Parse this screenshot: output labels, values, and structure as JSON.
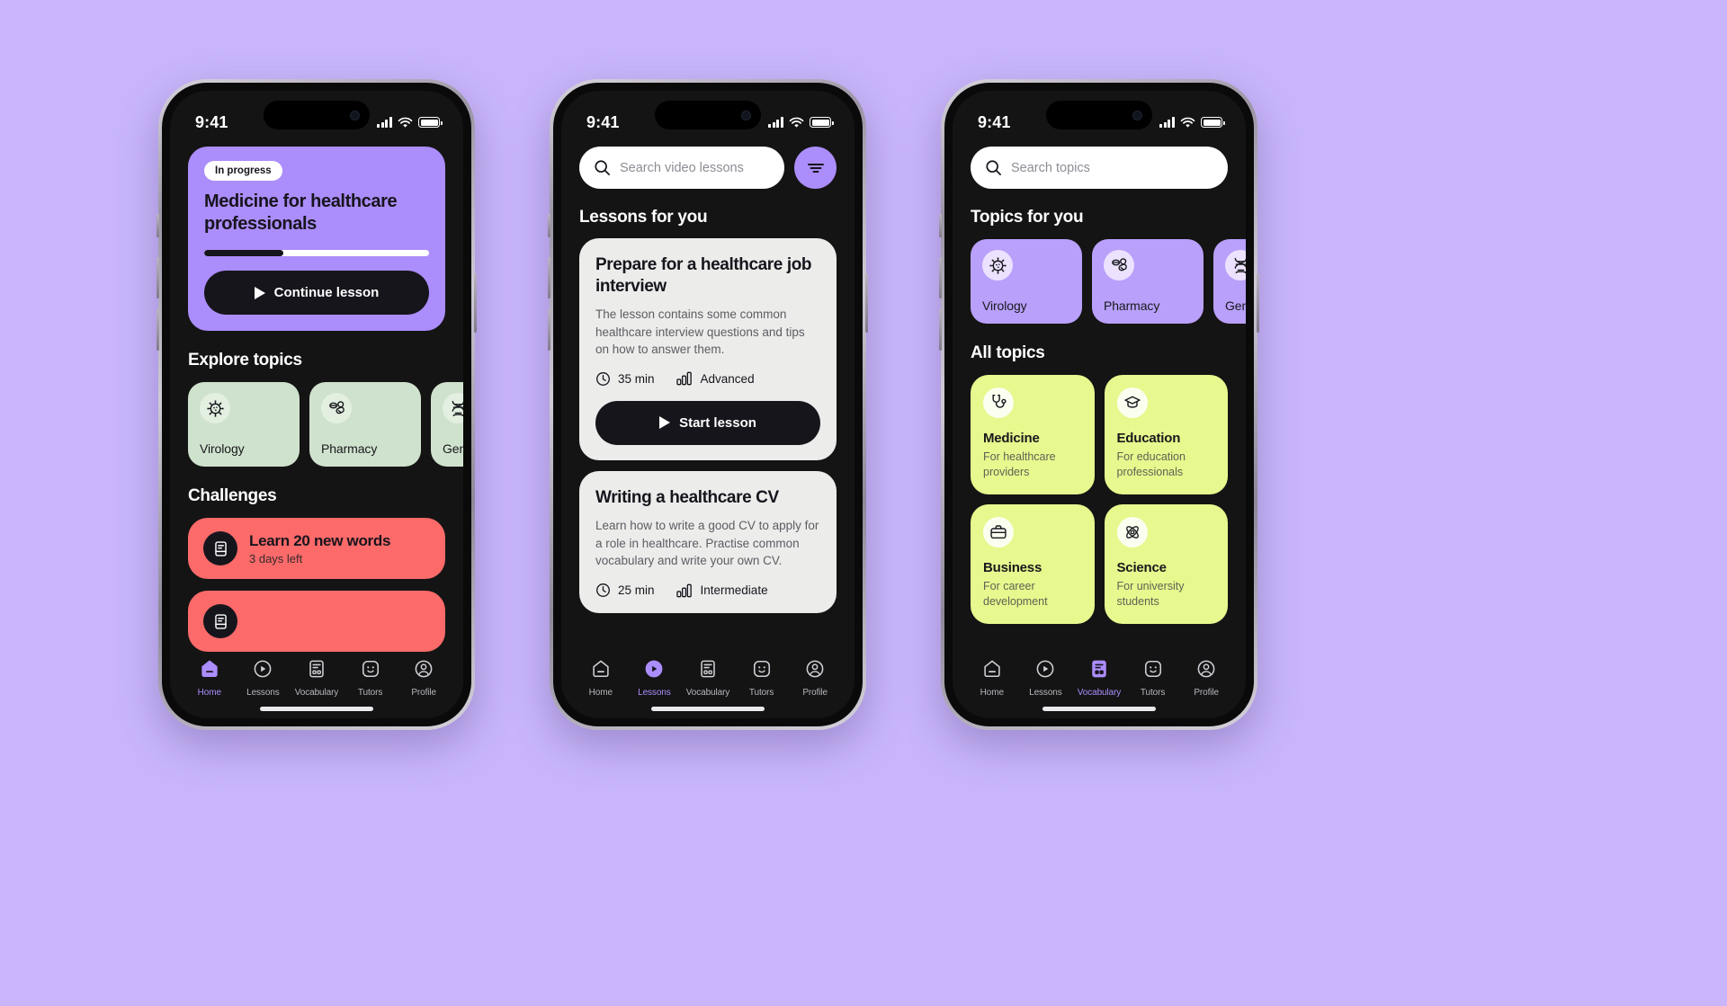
{
  "background_color": "#c9b6fa",
  "status_bar": {
    "time": "9:41",
    "signal_icon": "cellular-bars-icon",
    "wifi_icon": "wifi-icon",
    "battery_icon": "battery-icon"
  },
  "colors": {
    "purple": "#ab8dfb",
    "green_chip": "#cfe2cd",
    "lime": "#e7f88e",
    "red": "#fc6a6a",
    "dark": "#141414",
    "card_grey": "#ececeb"
  },
  "tabs": [
    {
      "label": "Home",
      "icon": "home-icon"
    },
    {
      "label": "Lessons",
      "icon": "play-circle-icon"
    },
    {
      "label": "Vocabulary",
      "icon": "vocabulary-book-icon"
    },
    {
      "label": "Tutors",
      "icon": "smiley-face-icon"
    },
    {
      "label": "Profile",
      "icon": "person-circle-icon"
    }
  ],
  "phone1": {
    "active_tab": "Home",
    "hero": {
      "status_pill": "In progress",
      "title": "Medicine for healthcare professionals",
      "progress_percent": 35,
      "button_label": "Continue lesson",
      "button_icon": "play-icon"
    },
    "explore_heading": "Explore topics",
    "topics": [
      {
        "label": "Virology",
        "icon": "virus-icon"
      },
      {
        "label": "Pharmacy",
        "icon": "pills-icon"
      },
      {
        "label": "Genetics",
        "icon": "dna-icon"
      }
    ],
    "challenges_heading": "Challenges",
    "challenges": [
      {
        "title": "Learn 20 new words",
        "subtitle": "3 days left",
        "icon": "flashcard-icon"
      },
      {
        "title": "",
        "subtitle": "",
        "icon": "flashcard-icon"
      }
    ]
  },
  "phone2": {
    "active_tab": "Lessons",
    "search": {
      "placeholder": "Search video lessons",
      "value": "",
      "icon": "search-icon"
    },
    "filter_button_icon": "filter-icon",
    "heading": "Lessons for you",
    "lessons": [
      {
        "title": "Prepare for a healthcare job interview",
        "description": "The lesson contains some common healthcare interview questions and tips on how to answer them.",
        "duration": "35 min",
        "level": "Advanced",
        "duration_icon": "clock-icon",
        "level_icon": "level-bars-icon",
        "button_label": "Start lesson",
        "button_icon": "play-icon"
      },
      {
        "title": "Writing a healthcare CV",
        "description": "Learn how to write a good CV to apply for a role in healthcare. Practise common vocabulary and write your own CV.",
        "duration": "25 min",
        "level": "Intermediate",
        "duration_icon": "clock-icon",
        "level_icon": "level-bars-icon"
      }
    ]
  },
  "phone3": {
    "active_tab": "Vocabulary",
    "search": {
      "placeholder": "Search topics",
      "value": "",
      "icon": "search-icon"
    },
    "topics_heading": "Topics for you",
    "topics": [
      {
        "label": "Virology",
        "icon": "virus-icon"
      },
      {
        "label": "Pharmacy",
        "icon": "pills-icon"
      },
      {
        "label": "Genetics",
        "icon": "dna-icon"
      }
    ],
    "all_heading": "All topics",
    "all_topics": [
      {
        "title": "Medicine",
        "subtitle": "For healthcare providers",
        "icon": "stethoscope-icon"
      },
      {
        "title": "Education",
        "subtitle": "For education professionals",
        "icon": "graduation-cap-icon"
      },
      {
        "title": "Business",
        "subtitle": "For career development",
        "icon": "briefcase-icon"
      },
      {
        "title": "Science",
        "subtitle": "For university students",
        "icon": "atom-icon"
      }
    ]
  }
}
